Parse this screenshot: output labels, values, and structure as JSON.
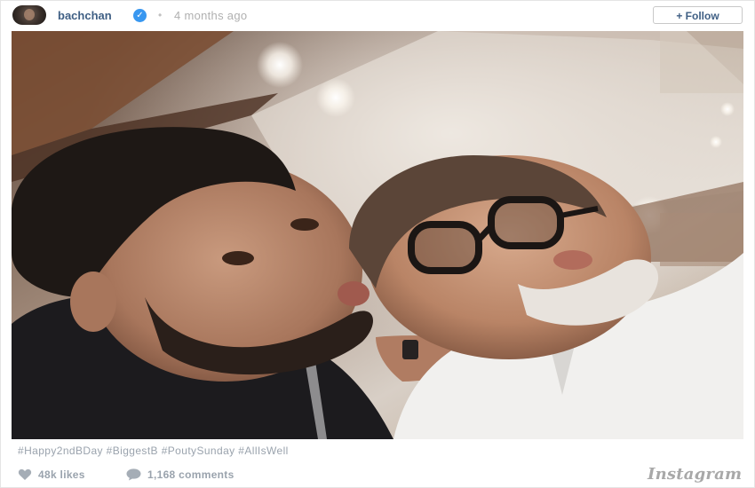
{
  "post": {
    "username": "bachchan",
    "verified_glyph": "✓",
    "separator": "•",
    "time_ago": "4 months ago",
    "follow_label": "+ Follow",
    "caption": "#Happy2ndBDay #BiggestB #PoutySunday #AllIsWell",
    "likes": "48k likes",
    "comments": "1,168 comments",
    "brand": "Instagram"
  },
  "icons": {
    "avatar": "avatar-photo",
    "verified": "verified-badge-icon",
    "heart": "heart-icon",
    "comment": "comment-bubble-icon"
  },
  "colors": {
    "username": "#3f5f84",
    "muted": "#9aa3ad",
    "verified": "#3897f0",
    "border": "#c8c8c8"
  }
}
